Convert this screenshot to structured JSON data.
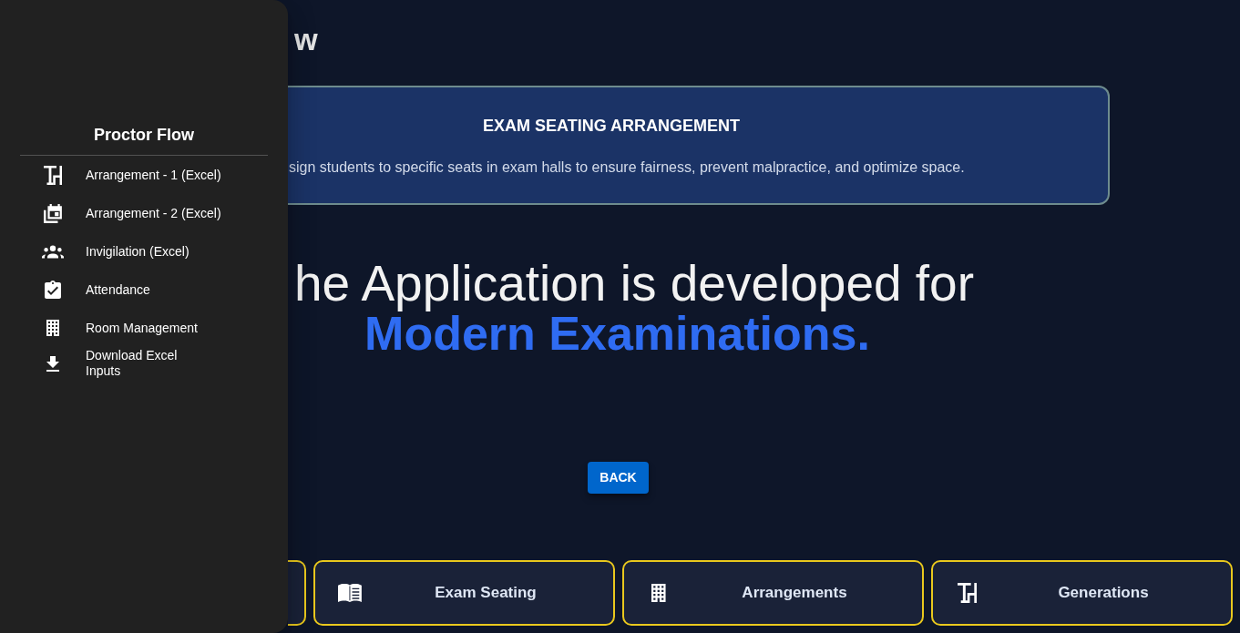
{
  "header": {
    "title": "w"
  },
  "info_card": {
    "title": "EXAM SEATING ARRANGEMENT",
    "description": "sign students to specific seats in exam halls to ensure fairness, prevent malpractice, and optimize space."
  },
  "hero": {
    "line_1": "he Application is developed for",
    "line_2": "Modern Examinations."
  },
  "back_button": {
    "label": "BACK"
  },
  "nav_cards": [
    {
      "kind": "covered"
    },
    {
      "kind": "full",
      "label": "Exam Seating"
    },
    {
      "kind": "full",
      "label": "Arrangements"
    },
    {
      "kind": "full",
      "label": "Generations"
    }
  ],
  "drawer": {
    "title": "Proctor Flow",
    "items": [
      {
        "label": "Arrangement - 1 (Excel)"
      },
      {
        "label": "Arrangement - 2 (Excel)"
      },
      {
        "label": "Invigilation (Excel)"
      },
      {
        "label": "Attendance"
      },
      {
        "label": "Room Management"
      },
      {
        "label": "Download Excel Inputs"
      }
    ]
  }
}
